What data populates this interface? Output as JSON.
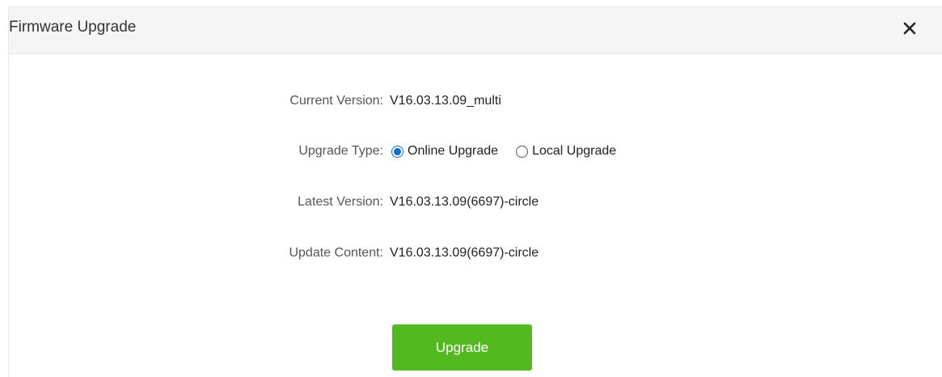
{
  "dialog": {
    "title": "Firmware Upgrade",
    "close_icon": "close-icon"
  },
  "fields": {
    "current_version": {
      "label": "Current Version:",
      "value": "V16.03.13.09_multi"
    },
    "upgrade_type": {
      "label": "Upgrade Type:",
      "options": [
        {
          "label": "Online Upgrade",
          "selected": true
        },
        {
          "label": "Local Upgrade",
          "selected": false
        }
      ]
    },
    "latest_version": {
      "label": "Latest Version:",
      "value": "V16.03.13.09(6697)-circle"
    },
    "update_content": {
      "label": "Update Content:",
      "value": "V16.03.13.09(6697)-circle"
    }
  },
  "actions": {
    "upgrade_label": "Upgrade"
  },
  "colors": {
    "header_bg": "#f5f5f5",
    "button_bg": "#52b91e",
    "radio_accent": "#0a6ed1"
  }
}
